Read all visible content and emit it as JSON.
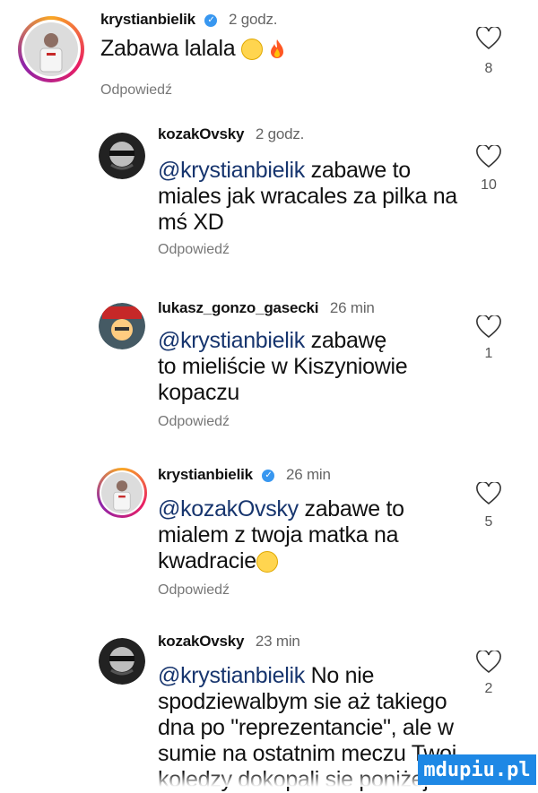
{
  "comments": [
    {
      "username": "krystianbielik",
      "verified": true,
      "time": "2 godz.",
      "text": "Zabawa lalala",
      "mention": "",
      "reply": "Odpowiedź",
      "likes": "8"
    },
    {
      "username": "kozakOvsky",
      "verified": false,
      "time": "2 godz.",
      "mention": "@krystianbielik",
      "text_line1": " zabawe to",
      "text_line2": "miales jak wracales za pilka na",
      "text_line3": "mś XD",
      "reply": "Odpowiedź",
      "likes": "10"
    },
    {
      "username": "lukasz_gonzo_gasecki",
      "verified": false,
      "time": "26 min",
      "mention": "@krystianbielik",
      "text_line1": " zabawę",
      "text_line2": "to mieliście w Kiszyniowie",
      "text_line3": "kopaczu",
      "reply": "Odpowiedź",
      "likes": "1"
    },
    {
      "username": "krystianbielik",
      "verified": true,
      "time": "26 min",
      "mention": "@kozakOvsky",
      "text_line1": " zabawe to",
      "text_line2": "mialem z twoja matka na",
      "text_line3": "kwadracie",
      "reply": "Odpowiedź",
      "likes": "5"
    },
    {
      "username": "kozakOvsky",
      "verified": false,
      "time": "23 min",
      "mention": "@krystianbielik",
      "text_line1": " No nie",
      "text_line2": "spodziewalbym sie aż takiego",
      "text_line3": "dna po \"reprezentancie\", ale w",
      "text_line4": "sumie na ostatnim meczu Twoi",
      "text_line5": "koledzy dokopali sie poniżej",
      "likes": "2"
    }
  ],
  "watermark": "mdupiu.pl",
  "colors": {
    "mention": "#17356e",
    "verified": "#3897f0",
    "watermark_bg": "#1e88e5"
  }
}
